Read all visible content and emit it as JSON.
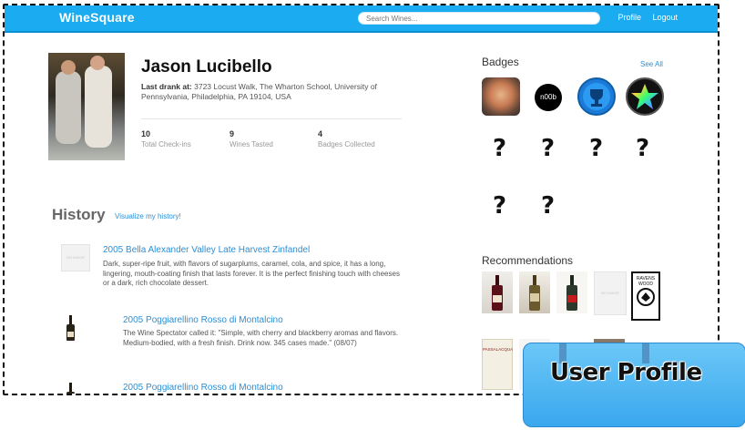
{
  "app": {
    "brand": "WineSquare"
  },
  "search": {
    "placeholder": "Search Wines..."
  },
  "nav": {
    "profile": "Profile",
    "logout": "Logout"
  },
  "user": {
    "name": "Jason Lucibello",
    "last_drank_label": "Last drank at:",
    "last_drank_value": "3723 Locust Walk, The Wharton School, University of Pennsylvania, Philadelphia, PA 19104, USA",
    "stats": [
      {
        "value": "10",
        "label": "Total Check-ins"
      },
      {
        "value": "9",
        "label": "Wines Tasted"
      },
      {
        "value": "4",
        "label": "Badges Collected"
      }
    ]
  },
  "history": {
    "title": "History",
    "link": "Visualize my history!",
    "items": [
      {
        "title": "2005 Bella Alexander Valley Late Harvest Zinfandel",
        "desc": "Dark, super-ripe fruit, with flavors of sugarplums, caramel, cola, and spice, it has a long, lingering, mouth-coating finish that lasts forever. It is the perfect finishing touch with cheeses or a dark, rich chocolate dessert.",
        "thumb_text": "NO IMAGE"
      },
      {
        "title": "2005 Poggiarellino Rosso di Montalcino",
        "desc": "The Wine Spectator called it: \"Simple, with cherry and blackberry aromas and flavors. Medium-bodied, with a fresh finish. Drink now. 345 cases made.\" (08/07)"
      },
      {
        "title": "2005 Poggiarellino Rosso di Montalcino"
      }
    ]
  },
  "badges": {
    "title": "Badges",
    "see_all": "See All",
    "earned": [
      {
        "icon": "face-badge-icon"
      },
      {
        "icon": "n00b-badge-icon",
        "text": "n00b"
      },
      {
        "icon": "trophy-badge-icon"
      },
      {
        "icon": "star-badge-icon"
      }
    ],
    "locked_symbol": "?"
  },
  "recommendations": {
    "title": "Recommendations",
    "noimage_text": "NO IMAGE",
    "ravenswood_text": "RAVENS WOOD",
    "passalacqua_text": "PASSALACQUA"
  },
  "overlay": {
    "label": "User Profile"
  },
  "colors": {
    "topbar": "#1aabf0",
    "link": "#2c8fd6",
    "tag": "#4db6f2"
  }
}
